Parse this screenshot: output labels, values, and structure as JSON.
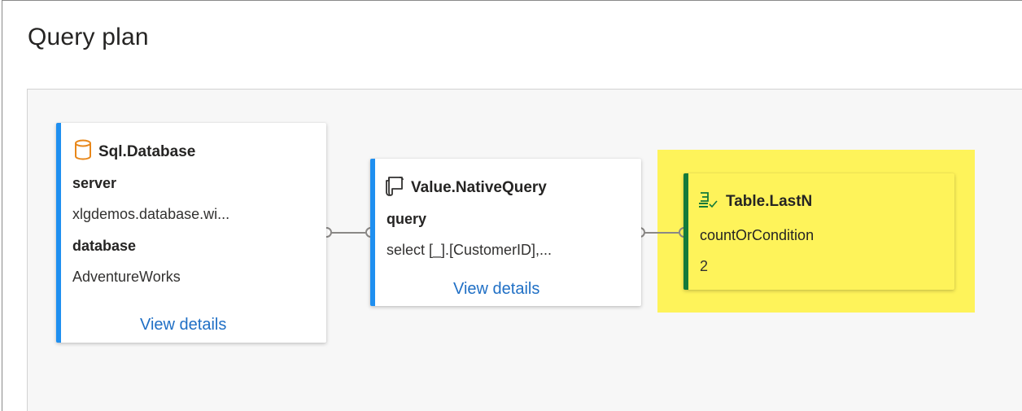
{
  "page": {
    "title": "Query plan"
  },
  "colors": {
    "accent_blue": "#1f8ff0",
    "accent_green": "#137a3a",
    "highlight": "#fef35a",
    "link": "#1f6fc5"
  },
  "nodes": [
    {
      "title": "Sql.Database",
      "icon": "database-icon",
      "fields": [
        {
          "label": "server",
          "value": "xlgdemos.database.wi..."
        },
        {
          "label": "database",
          "value": "AdventureWorks"
        }
      ],
      "link": "View details"
    },
    {
      "title": "Value.NativeQuery",
      "icon": "script-icon",
      "fields": [
        {
          "label": "query",
          "value": "select [_].[CustomerID],..."
        }
      ],
      "link": "View details"
    },
    {
      "title": "Table.LastN",
      "icon": "table-lastn-icon",
      "fields": [
        {
          "label": "countOrCondition",
          "value": "2"
        }
      ],
      "highlighted": true
    }
  ]
}
